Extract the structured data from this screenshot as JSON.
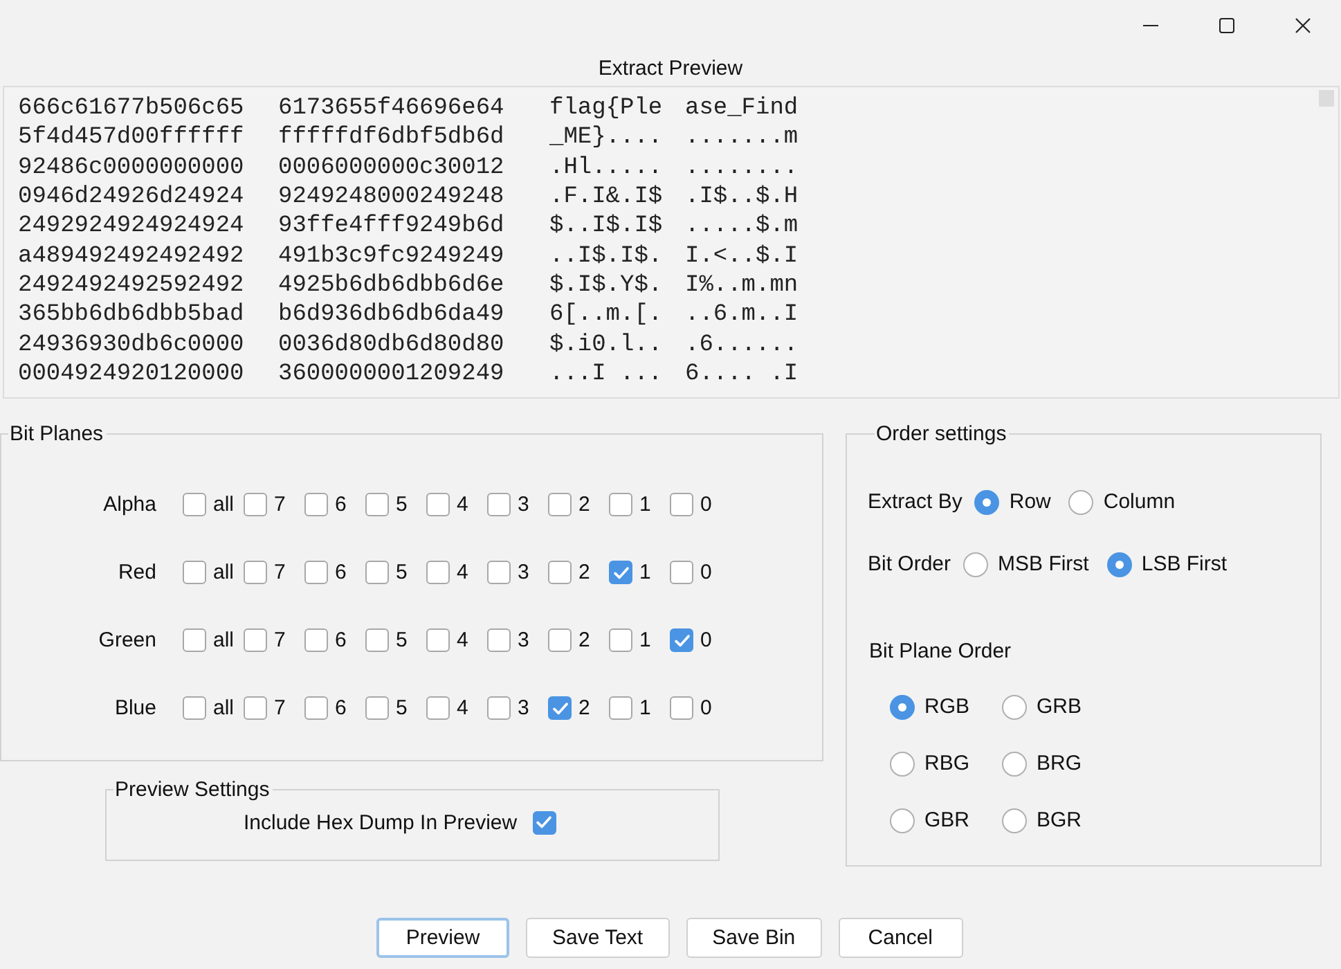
{
  "preview": {
    "label": "Extract Preview",
    "rows": [
      {
        "hex": [
          "666c61677b506c65",
          "6173655f46696e64"
        ],
        "ascii": [
          "flag{Ple",
          "ase_Find"
        ]
      },
      {
        "hex": [
          "5f4d457d00ffffff",
          "fffffdf6dbf5db6d"
        ],
        "ascii": [
          "_ME}....",
          ".......m"
        ]
      },
      {
        "hex": [
          "92486c0000000000",
          "0006000000c30012"
        ],
        "ascii": [
          ".Hl.....",
          "........"
        ]
      },
      {
        "hex": [
          "0946d24926d24924",
          "9249248000249248"
        ],
        "ascii": [
          ".F.I&.I$",
          ".I$..$.H"
        ]
      },
      {
        "hex": [
          "2492924924924924",
          "93ffe4fff9249b6d"
        ],
        "ascii": [
          "$..I$.I$",
          ".....$.m"
        ]
      },
      {
        "hex": [
          "a489492492492492",
          "491b3c9fc9249249"
        ],
        "ascii": [
          "..I$.I$.",
          "I.<..$.I"
        ]
      },
      {
        "hex": [
          "2492492492592492",
          "4925b6db6dbb6d6e"
        ],
        "ascii": [
          "$.I$.Y$.",
          "I%..m.mn"
        ]
      },
      {
        "hex": [
          "365bb6db6dbb5bad",
          "b6d936db6db6da49"
        ],
        "ascii": [
          "6[..m.[.",
          "..6.m..I"
        ]
      },
      {
        "hex": [
          "24936930db6c0000",
          "0036d80db6d80d80"
        ],
        "ascii": [
          "$.i0.l..",
          ".6......"
        ]
      },
      {
        "hex": [
          "0004924920120000",
          "3600000001209249"
        ],
        "ascii": [
          "...I ...",
          "6.... .I"
        ]
      }
    ]
  },
  "bit_planes": {
    "title": "Bit Planes",
    "channels": [
      {
        "name": "Alpha",
        "bits": [
          {
            "label": "all",
            "checked": false
          },
          {
            "label": "7",
            "checked": false
          },
          {
            "label": "6",
            "checked": false
          },
          {
            "label": "5",
            "checked": false
          },
          {
            "label": "4",
            "checked": false
          },
          {
            "label": "3",
            "checked": false
          },
          {
            "label": "2",
            "checked": false
          },
          {
            "label": "1",
            "checked": false
          },
          {
            "label": "0",
            "checked": false
          }
        ]
      },
      {
        "name": "Red",
        "bits": [
          {
            "label": "all",
            "checked": false
          },
          {
            "label": "7",
            "checked": false
          },
          {
            "label": "6",
            "checked": false
          },
          {
            "label": "5",
            "checked": false
          },
          {
            "label": "4",
            "checked": false
          },
          {
            "label": "3",
            "checked": false
          },
          {
            "label": "2",
            "checked": false
          },
          {
            "label": "1",
            "checked": true
          },
          {
            "label": "0",
            "checked": false
          }
        ]
      },
      {
        "name": "Green",
        "bits": [
          {
            "label": "all",
            "checked": false
          },
          {
            "label": "7",
            "checked": false
          },
          {
            "label": "6",
            "checked": false
          },
          {
            "label": "5",
            "checked": false
          },
          {
            "label": "4",
            "checked": false
          },
          {
            "label": "3",
            "checked": false
          },
          {
            "label": "2",
            "checked": false
          },
          {
            "label": "1",
            "checked": false
          },
          {
            "label": "0",
            "checked": true
          }
        ]
      },
      {
        "name": "Blue",
        "bits": [
          {
            "label": "all",
            "checked": false
          },
          {
            "label": "7",
            "checked": false
          },
          {
            "label": "6",
            "checked": false
          },
          {
            "label": "5",
            "checked": false
          },
          {
            "label": "4",
            "checked": false
          },
          {
            "label": "3",
            "checked": false
          },
          {
            "label": "2",
            "checked": true
          },
          {
            "label": "1",
            "checked": false
          },
          {
            "label": "0",
            "checked": false
          }
        ]
      }
    ]
  },
  "preview_settings": {
    "title": "Preview Settings",
    "include_hex_dump": {
      "label": "Include Hex Dump In Preview",
      "checked": true
    }
  },
  "order_settings": {
    "title": "Order settings",
    "extract_by": {
      "label": "Extract By",
      "options": [
        {
          "label": "Row",
          "selected": true
        },
        {
          "label": "Column",
          "selected": false
        }
      ]
    },
    "bit_order": {
      "label": "Bit Order",
      "options": [
        {
          "label": "MSB First",
          "selected": false
        },
        {
          "label": "LSB First",
          "selected": true
        }
      ]
    },
    "bit_plane_order": {
      "label": "Bit Plane Order",
      "options": [
        {
          "label": "RGB",
          "selected": true
        },
        {
          "label": "GRB",
          "selected": false
        },
        {
          "label": "RBG",
          "selected": false
        },
        {
          "label": "BRG",
          "selected": false
        },
        {
          "label": "GBR",
          "selected": false
        },
        {
          "label": "BGR",
          "selected": false
        }
      ]
    }
  },
  "buttons": [
    {
      "label": "Preview",
      "focused": true
    },
    {
      "label": "Save Text",
      "focused": false
    },
    {
      "label": "Save Bin",
      "focused": false
    },
    {
      "label": "Cancel",
      "focused": false
    }
  ]
}
